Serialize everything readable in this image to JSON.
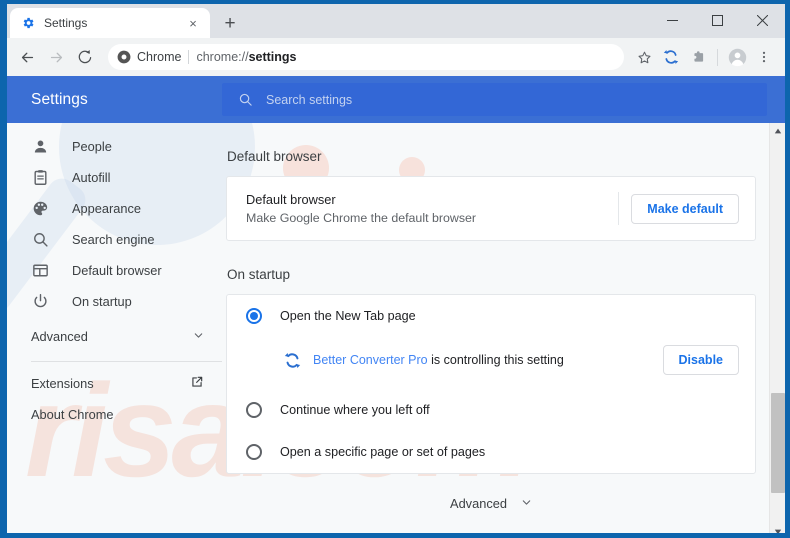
{
  "browser": {
    "tab": {
      "title": "Settings",
      "favicon": "gear-icon",
      "close": "×"
    },
    "new_tab_label": "+",
    "window_controls": {
      "minimize": "minimize-icon",
      "maximize": "maximize-icon",
      "close": "close-icon"
    },
    "toolbar": {
      "back": "back-arrow-icon",
      "forward": "forward-arrow-icon",
      "reload": "reload-icon",
      "chip_label": "Chrome",
      "url_prefix": "chrome://",
      "url_page": "settings",
      "bookmark": "star-icon",
      "extension_converter": "circular-arrows-icon",
      "extension_secondary": "puzzle-icon",
      "profile": "avatar-icon",
      "menu": "three-dot-menu-icon"
    }
  },
  "settings_header": {
    "title": "Settings",
    "search_placeholder": "Search settings",
    "search_icon": "search-icon"
  },
  "sidebar": {
    "items": [
      {
        "label": "People",
        "icon": "person-icon"
      },
      {
        "label": "Autofill",
        "icon": "clipboard-icon"
      },
      {
        "label": "Appearance",
        "icon": "palette-icon"
      },
      {
        "label": "Search engine",
        "icon": "search-icon"
      },
      {
        "label": "Default browser",
        "icon": "browser-window-icon"
      },
      {
        "label": "On startup",
        "icon": "power-icon"
      }
    ],
    "advanced": {
      "label": "Advanced",
      "icon": "chevron-down-icon"
    },
    "footer": [
      {
        "label": "Extensions",
        "icon": "external-link-icon"
      },
      {
        "label": "About Chrome",
        "icon": ""
      }
    ]
  },
  "main": {
    "default_browser": {
      "section_title": "Default browser",
      "row_title": "Default browser",
      "row_subtitle": "Make Google Chrome the default browser",
      "button": "Make default"
    },
    "on_startup": {
      "section_title": "On startup",
      "options": [
        {
          "label": "Open the New Tab page",
          "checked": true
        },
        {
          "label": "Continue where you left off",
          "checked": false
        },
        {
          "label": "Open a specific page or set of pages",
          "checked": false
        }
      ],
      "controlled_notice": {
        "icon": "circular-arrows-icon",
        "extension_name": "Better Converter Pro",
        "suffix": " is controlling this setting",
        "button": "Disable"
      }
    },
    "advanced_bottom": {
      "label": "Advanced",
      "icon": "chevron-down-icon"
    }
  },
  "scrollbar": {
    "up": "scroll-up-arrow-icon",
    "down": "scroll-down-arrow-icon"
  },
  "watermark": {
    "text": "risa.com"
  },
  "colors": {
    "frame": "#0d65ad",
    "header_blue": "#3b6fd4",
    "search_blue": "#3367d6",
    "accent_blue": "#1a73e8",
    "link_blue": "#4285f4",
    "page_bg": "#f7f9fa"
  }
}
